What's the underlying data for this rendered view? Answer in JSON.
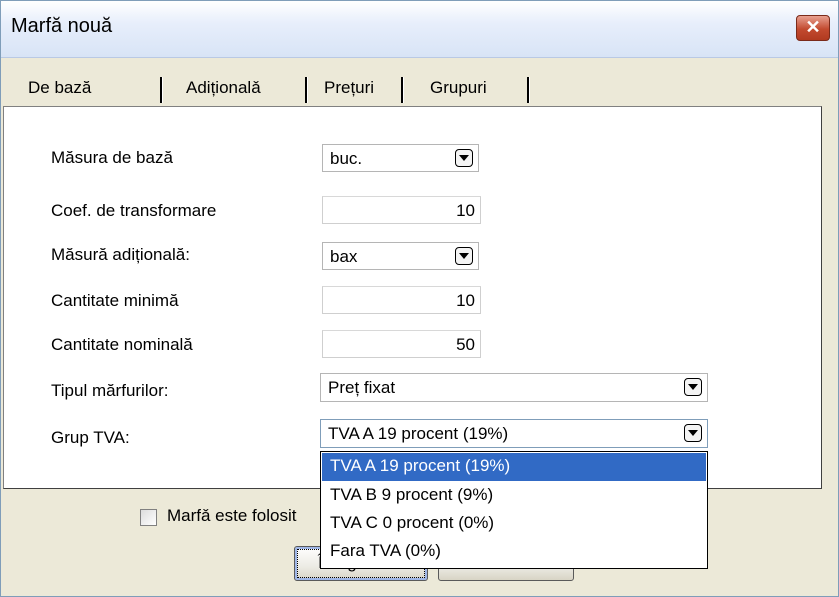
{
  "window": {
    "title": "Marfă nouă",
    "close_label": "✕"
  },
  "tabs": [
    {
      "label": "De bază"
    },
    {
      "label": "Adiționalǎ"
    },
    {
      "label": "Prețuri"
    },
    {
      "label": "Grupuri"
    }
  ],
  "form": {
    "base_unit": {
      "label": "Măsura de bază",
      "value": "buc."
    },
    "conversion_factor": {
      "label": "Coef. de transformare",
      "value": "10"
    },
    "additional_unit": {
      "label": "Măsură adițională:",
      "value": "bax"
    },
    "min_qty": {
      "label": "Cantitate minimă",
      "value": "10"
    },
    "nominal_qty": {
      "label": "Cantitate nominală",
      "value": "50"
    },
    "goods_type": {
      "label": "Tipul mărfurilor:",
      "value": "Preț fixat"
    },
    "vat_group": {
      "label": "Grup TVA:",
      "value": "TVA A 19 procent (19%)"
    }
  },
  "vat_options": [
    {
      "label": "TVA A 19 procent (19%)",
      "selected": true
    },
    {
      "label": "TVA B 9 procent (9%)",
      "selected": false
    },
    {
      "label": "TVA C 0 procent (0%)",
      "selected": false
    },
    {
      "label": "Fara TVA (0%)",
      "selected": false
    }
  ],
  "checkbox": {
    "label": "Marfǎ  este folosit",
    "checked": false
  },
  "buttons": {
    "save": "Înregistrare",
    "cancel": "Refuz"
  },
  "colors": {
    "selection": "#316ac5",
    "close_button": "#c24a2f"
  }
}
